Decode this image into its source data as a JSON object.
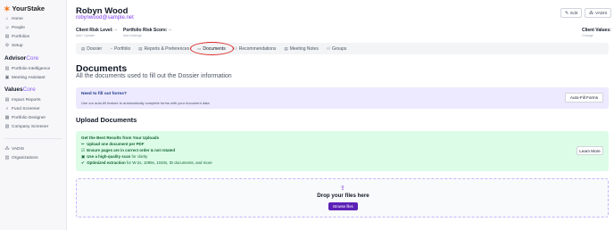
{
  "sidebar": {
    "brand": "YourStake",
    "items_top": [
      {
        "icon": "home-icon",
        "glyph": "⌂",
        "label": "Home"
      },
      {
        "icon": "people-icon",
        "glyph": "☺",
        "label": "People"
      },
      {
        "icon": "portfolios-icon",
        "glyph": "▤",
        "label": "Portfolios"
      },
      {
        "icon": "setup-icon",
        "glyph": "⚙",
        "label": "Setup"
      }
    ],
    "advisor_section": {
      "title": "Advisor",
      "accent": "Core"
    },
    "items_advisor": [
      {
        "icon": "portfolio-intelligence-icon",
        "glyph": "▥",
        "label": "Portfolio Intelligence"
      },
      {
        "icon": "meeting-assistant-icon",
        "glyph": "▣",
        "label": "Meeting Assistant"
      }
    ],
    "values_section": {
      "title": "Values",
      "accent": "Core"
    },
    "items_values": [
      {
        "icon": "impact-reports-icon",
        "glyph": "▤",
        "label": "Impact Reports"
      },
      {
        "icon": "fund-screener-icon",
        "glyph": "⌕",
        "label": "Fund Screener"
      },
      {
        "icon": "portfolio-designer-icon",
        "glyph": "▦",
        "label": "Portfolio Designer"
      },
      {
        "icon": "company-screener-icon",
        "glyph": "▧",
        "label": "Company Screener"
      }
    ],
    "items_bottom": [
      {
        "icon": "vadis-icon",
        "glyph": "⁂",
        "label": "VADIS"
      },
      {
        "icon": "organizations-icon",
        "glyph": "▥",
        "label": "Organizations"
      }
    ]
  },
  "header": {
    "name": "Robyn Wood",
    "email": "robynwood@sample.net",
    "edit_label": "Edit",
    "vadis_label": "VADIS"
  },
  "meta": {
    "client_risk_label": "Client Risk Level:",
    "client_risk_value": "--",
    "client_risk_sub": "Add / Update",
    "portfolio_risk_label": "Portfolio Risk Score:",
    "portfolio_risk_value": "--",
    "portfolio_risk_sub": "Add holdings",
    "client_values_label": "Client Values:",
    "client_values_sub": "Change"
  },
  "tabs": [
    {
      "icon": "dossier-icon",
      "glyph": "▤",
      "label": "Dossier"
    },
    {
      "icon": "portfolio-icon",
      "glyph": "◔",
      "label": "Portfolio"
    },
    {
      "icon": "reports-icon",
      "glyph": "▤",
      "label": "Reports & Preferences"
    },
    {
      "icon": "documents-icon",
      "glyph": "▭",
      "label": "Documents",
      "active": true
    },
    {
      "icon": "recommendations-icon",
      "glyph": "⚇",
      "label": "Recommendations"
    },
    {
      "icon": "meeting-notes-icon",
      "glyph": "▤",
      "label": "Meeting Notes"
    },
    {
      "icon": "groups-icon",
      "glyph": "⚇",
      "label": "Groups"
    }
  ],
  "main": {
    "title": "Documents",
    "subtitle": "All the documents used to fill out the Dossier information",
    "forms_title": "Need to fill out forms?",
    "forms_desc": "Use our auto-fill feature to automatically complete forms with your document data",
    "autofill_label": "Auto-Fill Forms",
    "upload_title": "Upload Documents",
    "tips_title": "Get the Best Results from Your Uploads",
    "tips": [
      {
        "emoji": "✏",
        "bold": "Upload one document per PDF",
        "rest": ""
      },
      {
        "emoji": "☑",
        "bold": "Ensure pages are in correct order & not rotated",
        "rest": ""
      },
      {
        "emoji": "▣",
        "bold": "Use a high-quality scan",
        "rest": " for clarity"
      },
      {
        "emoji": "✔",
        "bold": "Optimized extraction",
        "rest": " for W-2s, 1099s, 1040s, ID documents, and more"
      }
    ],
    "learn_more_label": "Learn More",
    "drop_title": "Drop your files here",
    "browse_label": "Browse files"
  },
  "colors": {
    "accent": "#7c3aed",
    "brand_orange": "#f97316",
    "purple_panel": "#ede9fe",
    "green_panel": "#dcfce7",
    "highlight_circle": "#dc2626"
  }
}
